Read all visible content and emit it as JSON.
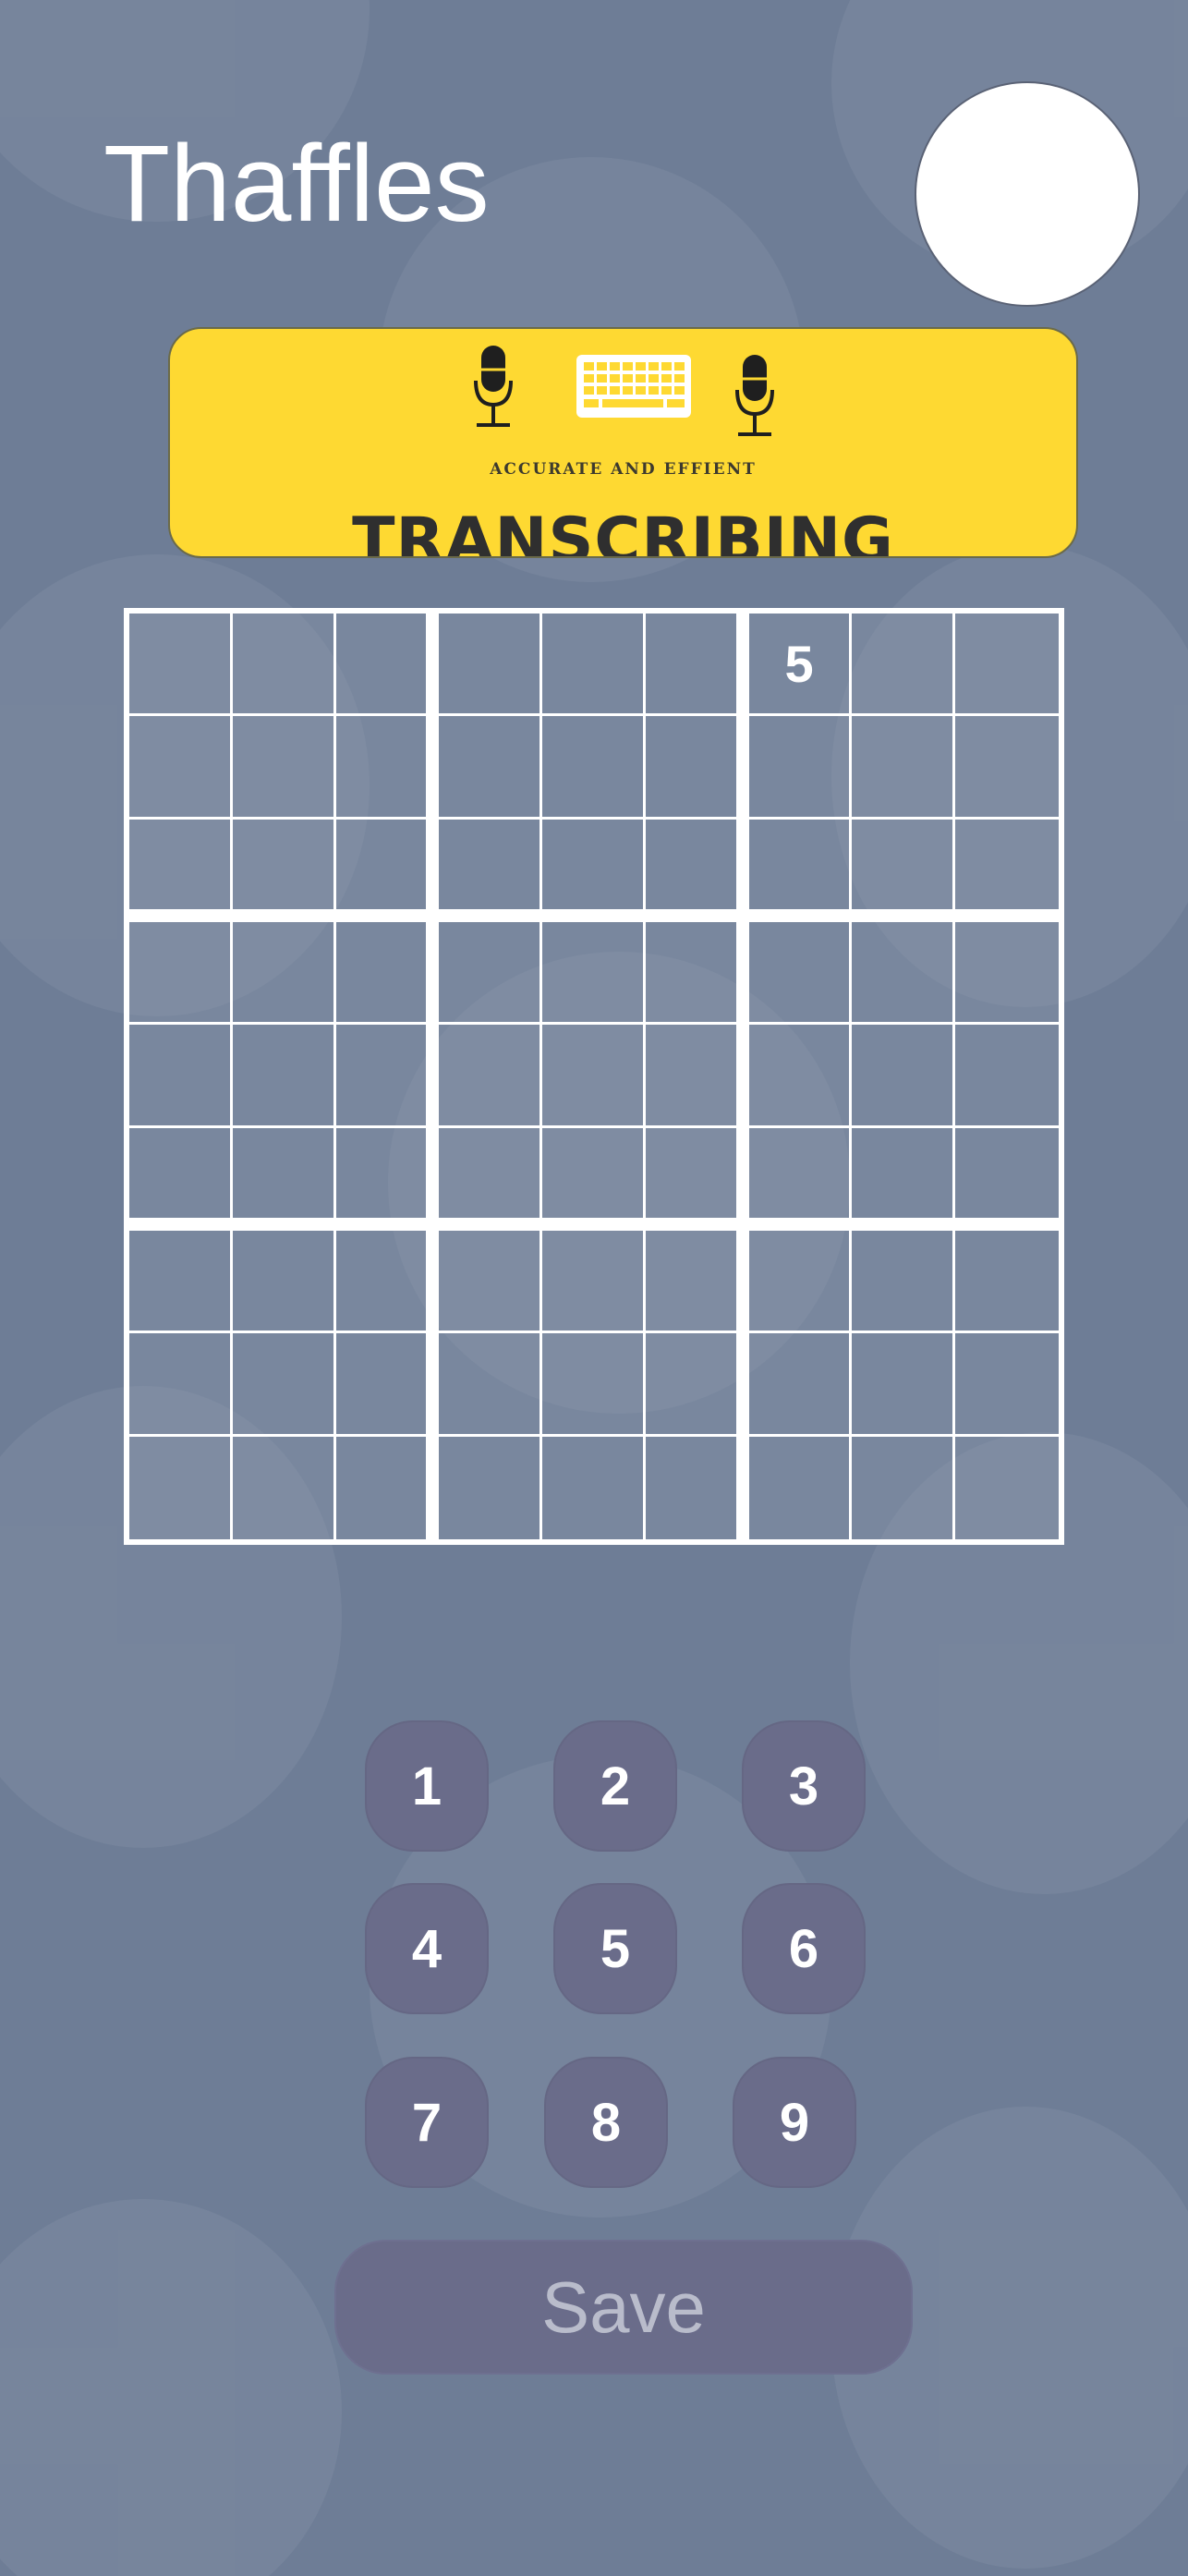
{
  "app": {
    "title": "Thaffles"
  },
  "banner": {
    "subtitle": "ACCURATE AND EFFIENT",
    "headline": "TRANSCRIBING",
    "background_color": "#fed932",
    "icons": [
      "microphone-icon",
      "keyboard-icon",
      "microphone-icon"
    ]
  },
  "board": {
    "size": 9,
    "cells": [
      [
        "",
        "",
        "",
        "",
        "",
        "",
        "5",
        "",
        ""
      ],
      [
        "",
        "",
        "",
        "",
        "",
        "",
        "",
        "",
        ""
      ],
      [
        "",
        "",
        "",
        "",
        "",
        "",
        "",
        "",
        ""
      ],
      [
        "",
        "",
        "",
        "",
        "",
        "",
        "",
        "",
        ""
      ],
      [
        "",
        "",
        "",
        "",
        "",
        "",
        "",
        "",
        ""
      ],
      [
        "",
        "",
        "",
        "",
        "",
        "",
        "",
        "",
        ""
      ],
      [
        "",
        "",
        "",
        "",
        "",
        "",
        "",
        "",
        ""
      ],
      [
        "",
        "",
        "",
        "",
        "",
        "",
        "",
        "",
        ""
      ],
      [
        "",
        "",
        "",
        "",
        "",
        "",
        "",
        "",
        ""
      ]
    ]
  },
  "keypad": {
    "keys": [
      "1",
      "2",
      "3",
      "4",
      "5",
      "6",
      "7",
      "8",
      "9"
    ],
    "save_label": "Save"
  },
  "colors": {
    "background": "#6e7d96",
    "key": "#6a6c8a",
    "grid_line": "#ffffff"
  }
}
